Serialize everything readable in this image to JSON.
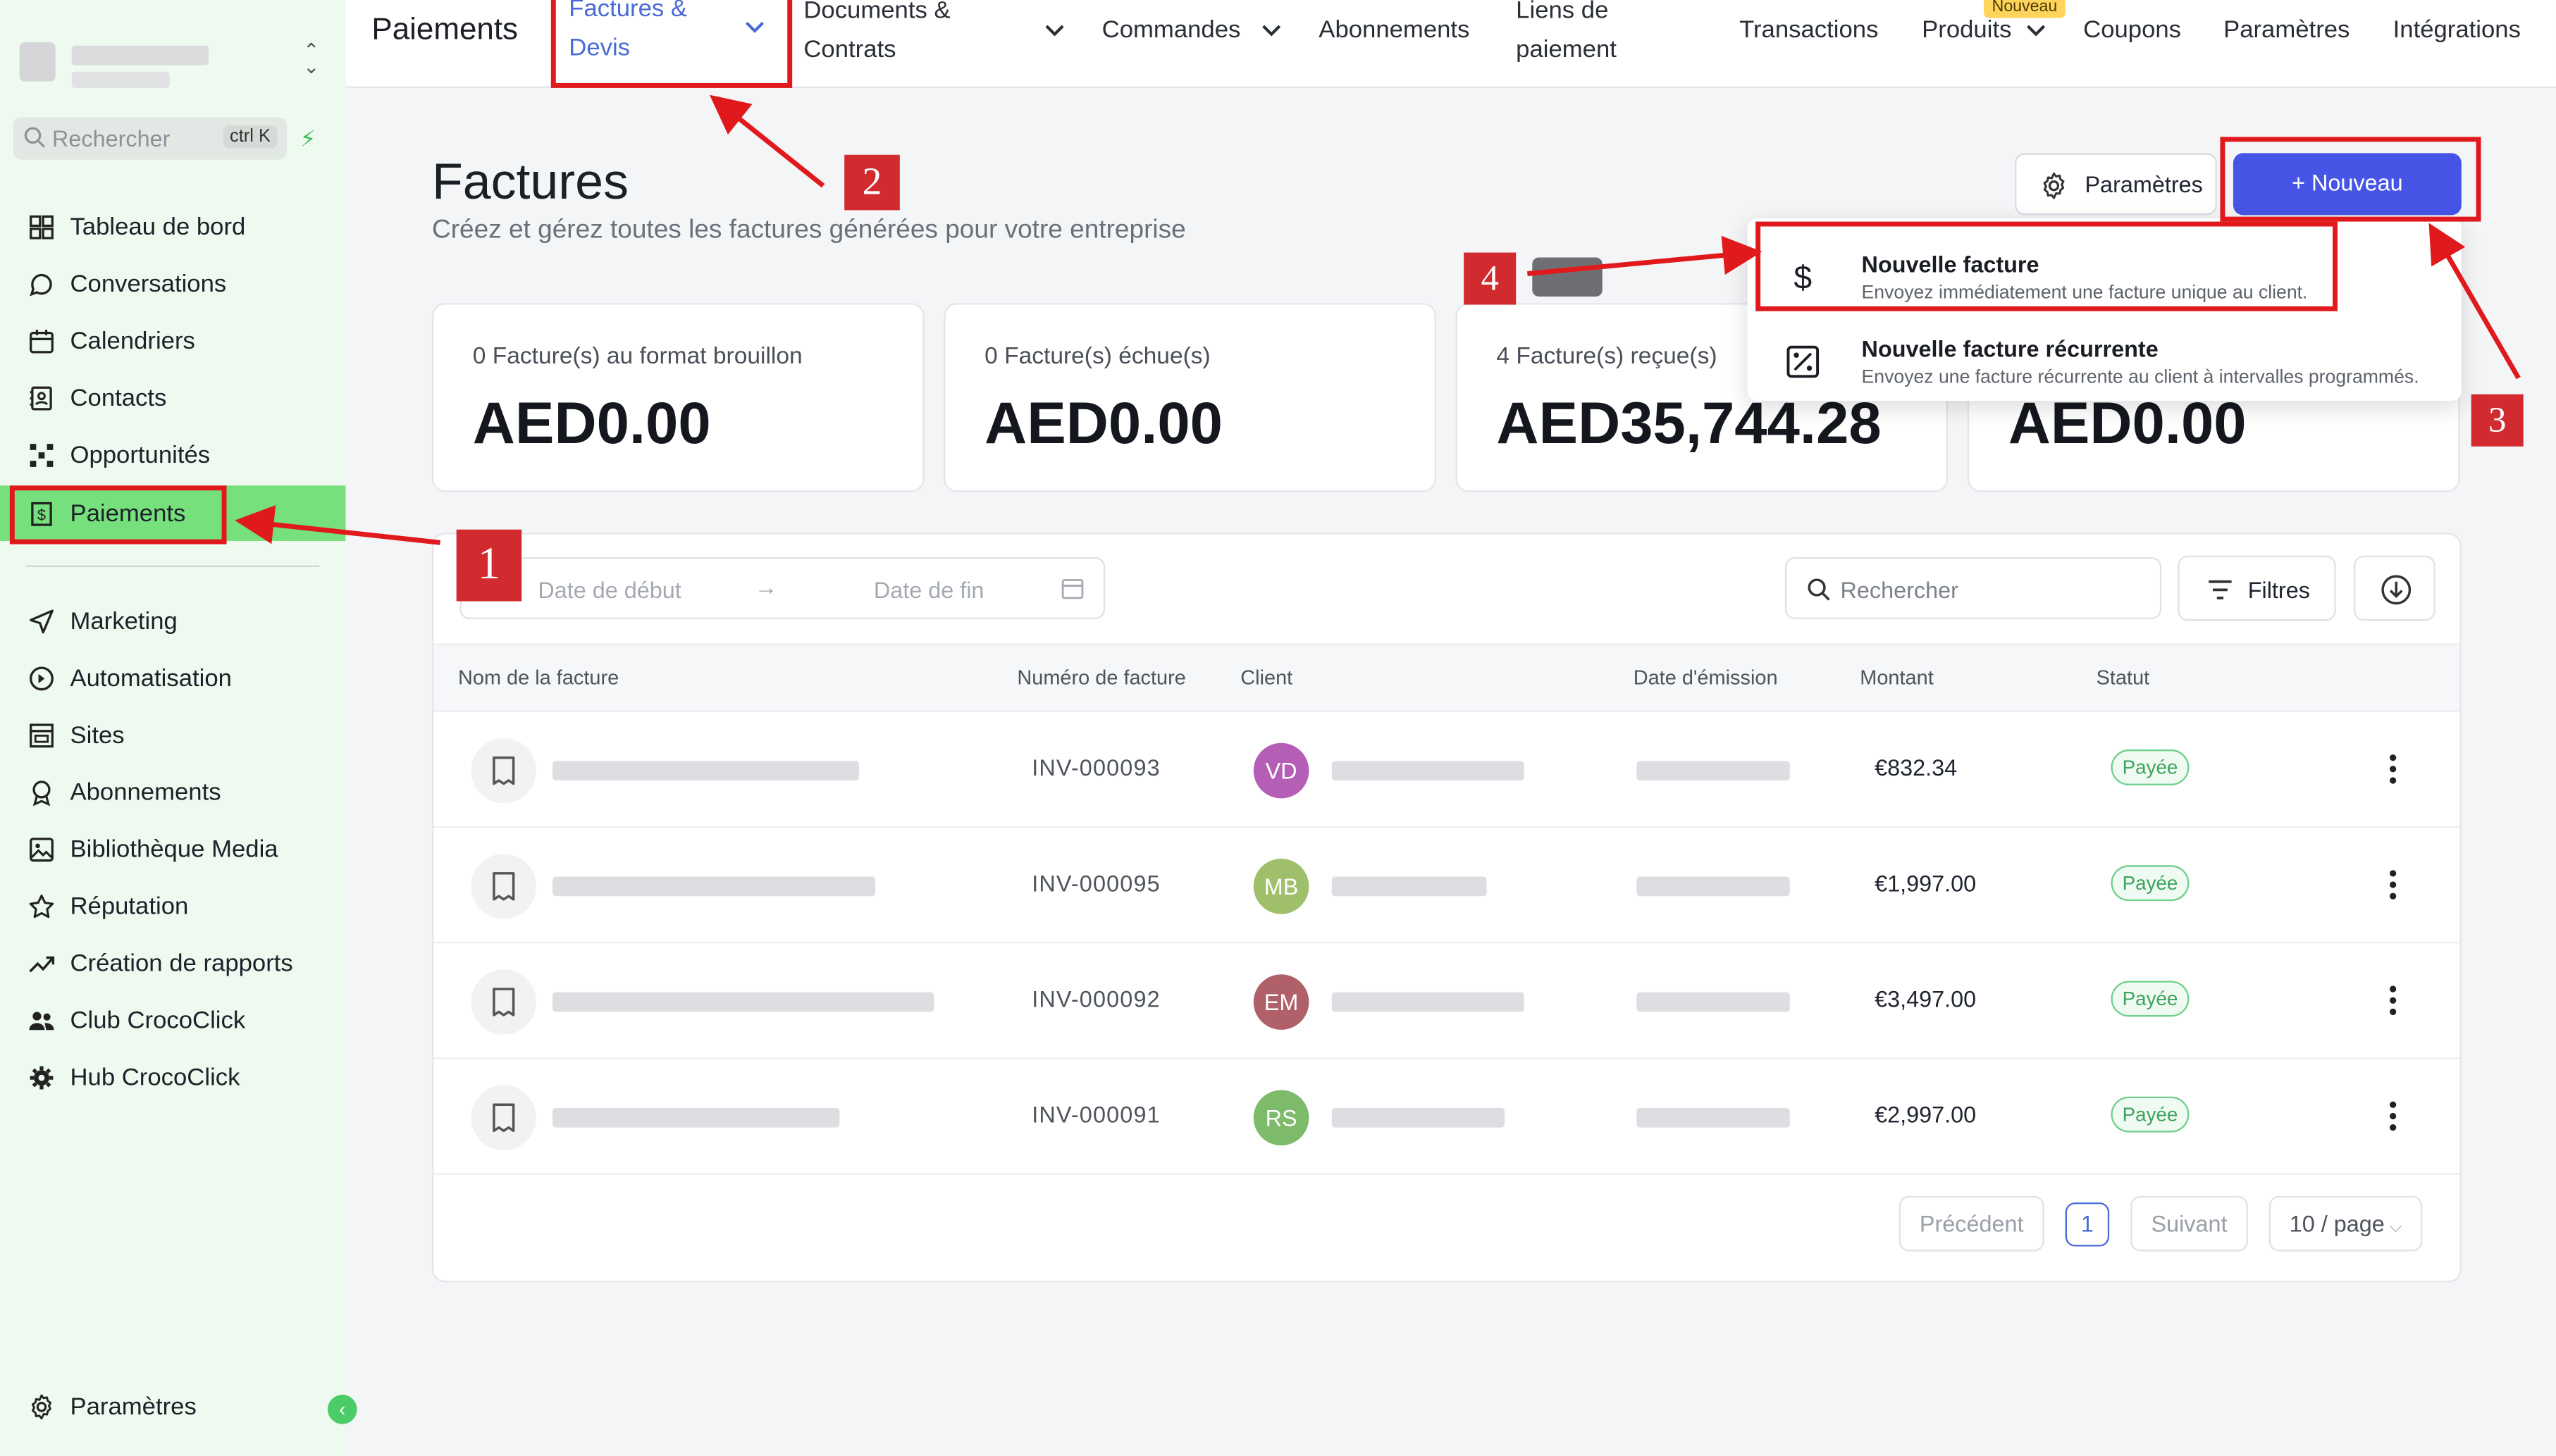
{
  "sidebar": {
    "search_placeholder": "Rechercher",
    "search_shortcut": "ctrl K",
    "items": [
      {
        "label": "Tableau de bord"
      },
      {
        "label": "Conversations"
      },
      {
        "label": "Calendriers"
      },
      {
        "label": "Contacts"
      },
      {
        "label": "Opportunités"
      },
      {
        "label": "Paiements"
      },
      {
        "label": "Marketing"
      },
      {
        "label": "Automatisation"
      },
      {
        "label": "Sites"
      },
      {
        "label": "Abonnements"
      },
      {
        "label": "Bibliothèque Media"
      },
      {
        "label": "Réputation"
      },
      {
        "label": "Création de rapports"
      },
      {
        "label": "Club CrocoClick"
      },
      {
        "label": "Hub CrocoClick"
      }
    ],
    "settings_label": "Paramètres",
    "active_color": "#75e07c"
  },
  "topnav": {
    "title": "Paiements",
    "tabs": [
      {
        "label_line1": "Factures &",
        "label_line2": "Devis"
      },
      {
        "label_line1": "Documents &",
        "label_line2": "Contrats"
      },
      {
        "label": "Commandes"
      },
      {
        "label": "Abonnements"
      },
      {
        "label_line1": "Liens de",
        "label_line2": "paiement"
      },
      {
        "label": "Transactions"
      },
      {
        "label": "Produits",
        "badge": "Nouveau"
      },
      {
        "label": "Coupons"
      },
      {
        "label": "Paramètres"
      },
      {
        "label": "Intégrations"
      }
    ]
  },
  "main": {
    "title": "Factures",
    "subtitle": "Créez et gérez toutes les factures générées pour votre entreprise",
    "settings_button": "Paramètres",
    "new_button": "+ Nouveau",
    "accent_color": "#4655e6",
    "stats": [
      {
        "label": "0 Facture(s) au format brouillon",
        "value": "AED0.00"
      },
      {
        "label": "0 Facture(s) échue(s)",
        "value": "AED0.00"
      },
      {
        "label": "4 Facture(s) reçue(s)",
        "value": "AED35,744.28"
      },
      {
        "label": "",
        "value": "AED0.00"
      }
    ]
  },
  "dropdown": {
    "items": [
      {
        "title": "Nouvelle facture",
        "desc": "Envoyez immédiatement une facture unique au client."
      },
      {
        "title": "Nouvelle facture récurrente",
        "desc": "Envoyez une facture récurrente au client à intervalles programmés."
      }
    ]
  },
  "table": {
    "date_start_placeholder": "Date de début",
    "date_end_placeholder": "Date de fin",
    "search_placeholder": "Rechercher",
    "filters_label": "Filtres",
    "columns": [
      "Nom de la facture",
      "Numéro de facture",
      "Client",
      "Date d'émission",
      "Montant",
      "Statut"
    ],
    "rows": [
      {
        "number": "INV-000093",
        "initials": "VD",
        "avatar_color": "#b45fb5",
        "amount": "€832.34",
        "status": "Payée"
      },
      {
        "number": "INV-000095",
        "initials": "MB",
        "avatar_color": "#9fbf6a",
        "amount": "€1,997.00",
        "status": "Payée"
      },
      {
        "number": "INV-000092",
        "initials": "EM",
        "avatar_color": "#b06068",
        "amount": "€3,497.00",
        "status": "Payée"
      },
      {
        "number": "INV-000091",
        "initials": "RS",
        "avatar_color": "#7dba6a",
        "amount": "€2,997.00",
        "status": "Payée"
      }
    ],
    "pagination": {
      "prev": "Précédent",
      "current": "1",
      "next": "Suivant",
      "per_page": "10 / page"
    }
  },
  "annotations": {
    "numbers": [
      "1",
      "2",
      "3",
      "4"
    ],
    "color": "#e0191d"
  }
}
